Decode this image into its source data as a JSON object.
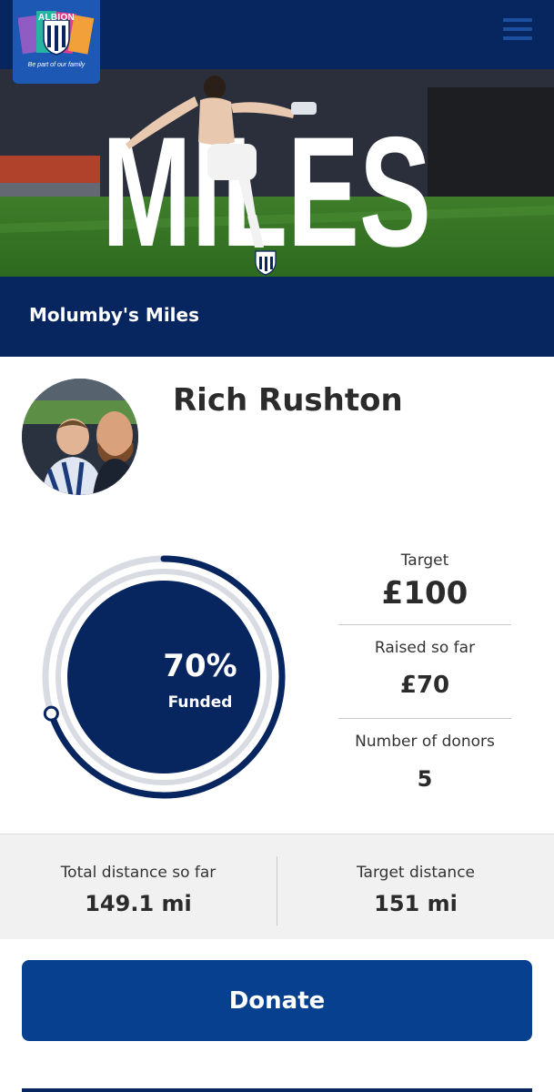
{
  "header": {
    "logo": {
      "brand": "ALBION",
      "tagline": "Be part of our family",
      "colors": [
        "#e23a8f",
        "#26b5a3",
        "#8e5cc2",
        "#f2a13a",
        "#2aa6e0"
      ]
    },
    "menu_icon": "hamburger-menu-icon",
    "background": "#07255f"
  },
  "hero": {
    "headline": "MILES",
    "badge_icon": "club-crest-icon"
  },
  "campaign": {
    "title": "Molumby's Miles"
  },
  "profile": {
    "name": "Rich Rushton",
    "avatar_icon": "profile-photo"
  },
  "progress": {
    "percent_label": "70%",
    "status_label": "Funded",
    "fraction_funded": 0.7,
    "accent": "#07255f",
    "track": "#d8dbe2"
  },
  "stats": {
    "target_label": "Target",
    "target_value": "£100",
    "raised_label": "Raised so far",
    "raised_value": "£70",
    "donors_label": "Number of donors",
    "donors_value": "5"
  },
  "distance": {
    "total_label": "Total distance so far",
    "total_value": "149.1 mi",
    "target_label": "Target distance",
    "target_value": "151 mi"
  },
  "actions": {
    "donate_label": "Donate",
    "button_color": "#07408f"
  }
}
